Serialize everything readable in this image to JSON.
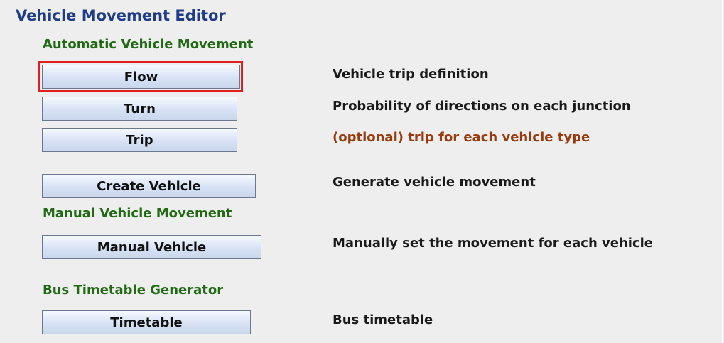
{
  "panel": {
    "title": "Vehicle Movement Editor",
    "sections": {
      "automatic": "Automatic Vehicle Movement",
      "manual": "Manual Vehicle Movement",
      "bus": "Bus Timetable Generator"
    },
    "buttons": {
      "flow": "Flow",
      "turn": "Turn",
      "trip": "Trip",
      "create_vehicle": "Create Vehicle",
      "manual_vehicle": "Manual Vehicle",
      "timetable": "Timetable"
    },
    "descriptions": {
      "flow": "Vehicle trip definition",
      "turn": "Probability of directions on each junction",
      "trip": "(optional) trip for each vehicle type",
      "create_vehicle": "Generate vehicle movement",
      "manual_vehicle": "Manually set the movement for each vehicle",
      "timetable": "Bus timetable"
    }
  },
  "colors": {
    "title": "#1f3c8a",
    "section": "#1f6a12",
    "optional_text": "#9a3a0d",
    "highlight": "#e01f1f"
  }
}
